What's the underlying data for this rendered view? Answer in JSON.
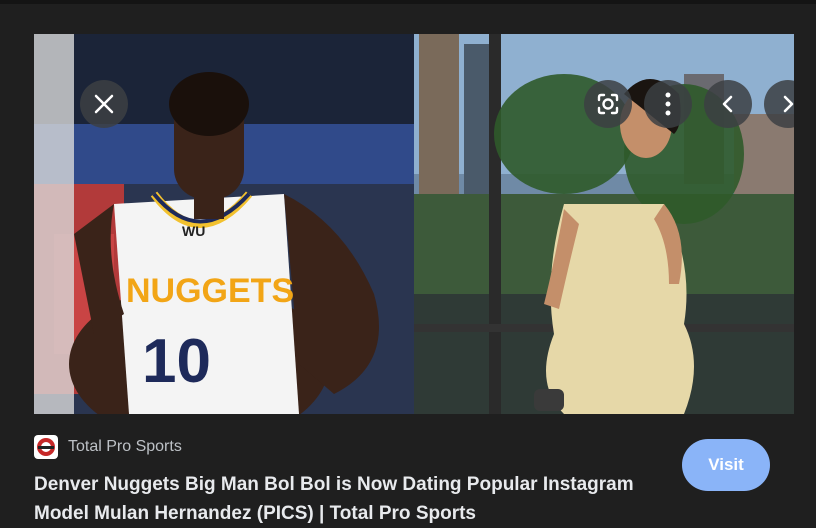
{
  "controls": {
    "close_icon": "close-icon",
    "lens_icon": "google-lens-icon",
    "more_icon": "more-vertical-icon",
    "prev_icon": "chevron-left-icon",
    "next_icon": "chevron-right-icon"
  },
  "images": {
    "left_jersey_text": "NUGGETS",
    "left_jersey_number": "10",
    "left_sponsor_text": "WU"
  },
  "source": {
    "name": "Total Pro Sports",
    "favicon": "total-pro-sports-logo"
  },
  "result": {
    "title": "Denver Nuggets Big Man Bol Bol is Now Dating Popular Instagram Model Mulan Hernandez (PICS) | Total Pro Sports"
  },
  "actions": {
    "visit_label": "Visit"
  },
  "colors": {
    "background": "#1f1f1f",
    "accent": "#8ab4f8",
    "title_text": "#e8eaed",
    "source_text": "#bdc1c6"
  }
}
